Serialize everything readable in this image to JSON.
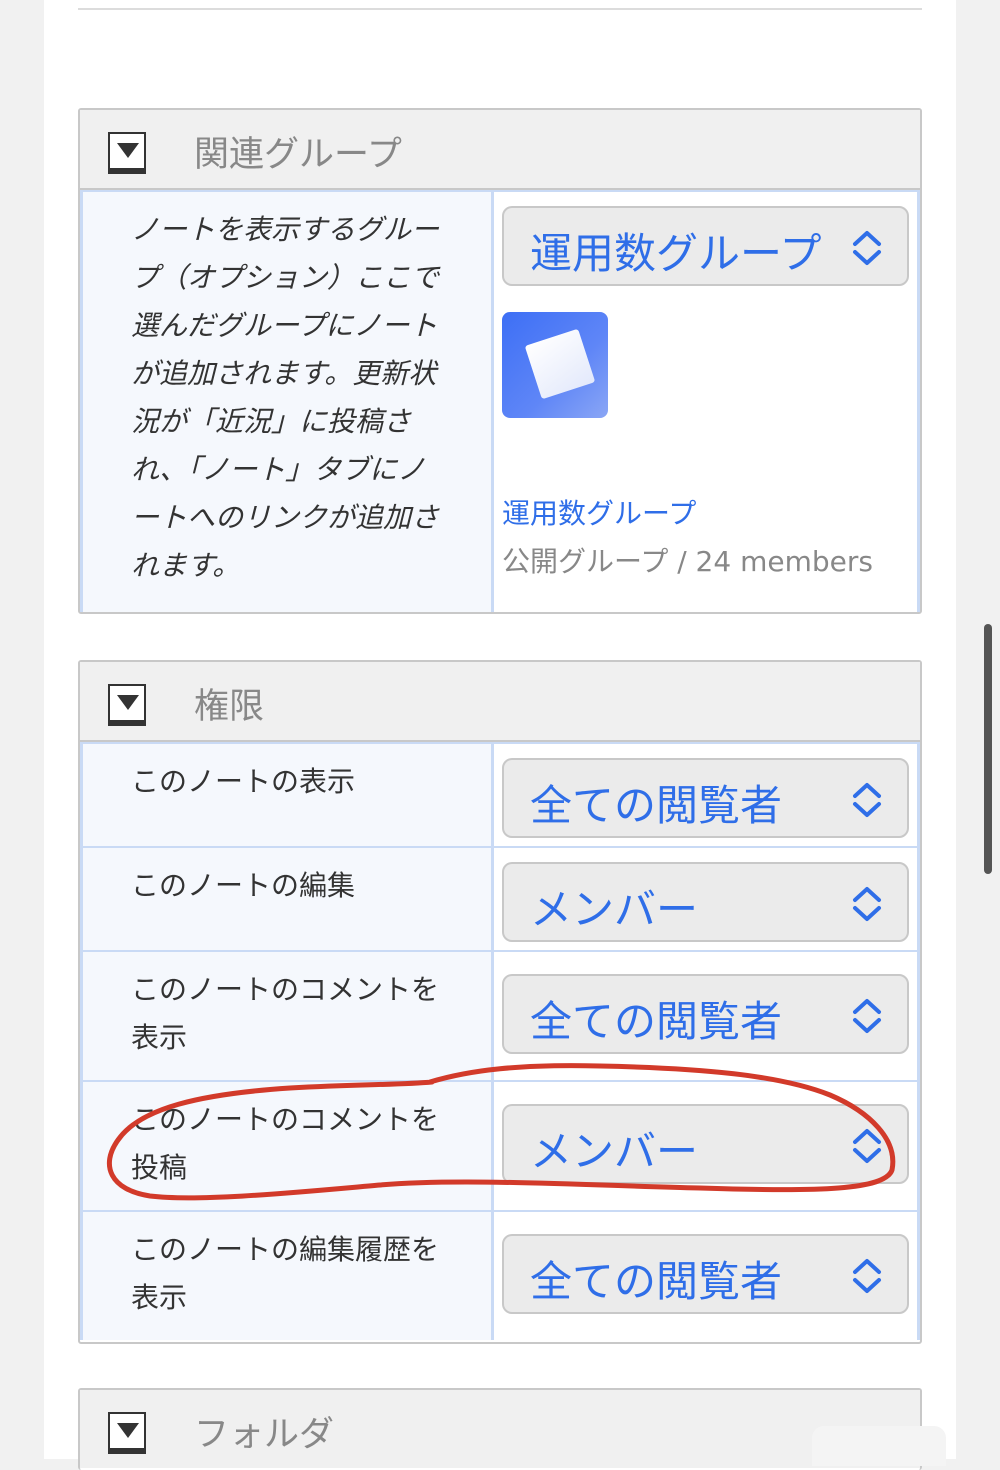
{
  "related_group": {
    "title": "関連グループ",
    "description": "ノートを表示するグループ（オプション）ここで選んだグループにノートが追加されます。更新状況が「近況」に投稿され、「ノート」タブにノートへのリンクが追加されます。",
    "selected": "運用数グループ",
    "group_name": "運用数グループ",
    "group_meta": "公開グループ / 24 members"
  },
  "permissions": {
    "title": "権限",
    "rows": [
      {
        "label": "このノートの表示",
        "value": "全ての閲覧者"
      },
      {
        "label": "このノートの編集",
        "value": "メンバー"
      },
      {
        "label": "このノートのコメントを表示",
        "value": "全ての閲覧者"
      },
      {
        "label": "このノートのコメントを投稿",
        "value": "メンバー"
      },
      {
        "label": "このノートの編集履歴を表示",
        "value": "全ての閲覧者"
      }
    ]
  },
  "folder": {
    "title": "フォルダ"
  },
  "colors": {
    "accent": "#2f6ee8",
    "annotation": "#d23a2a"
  }
}
